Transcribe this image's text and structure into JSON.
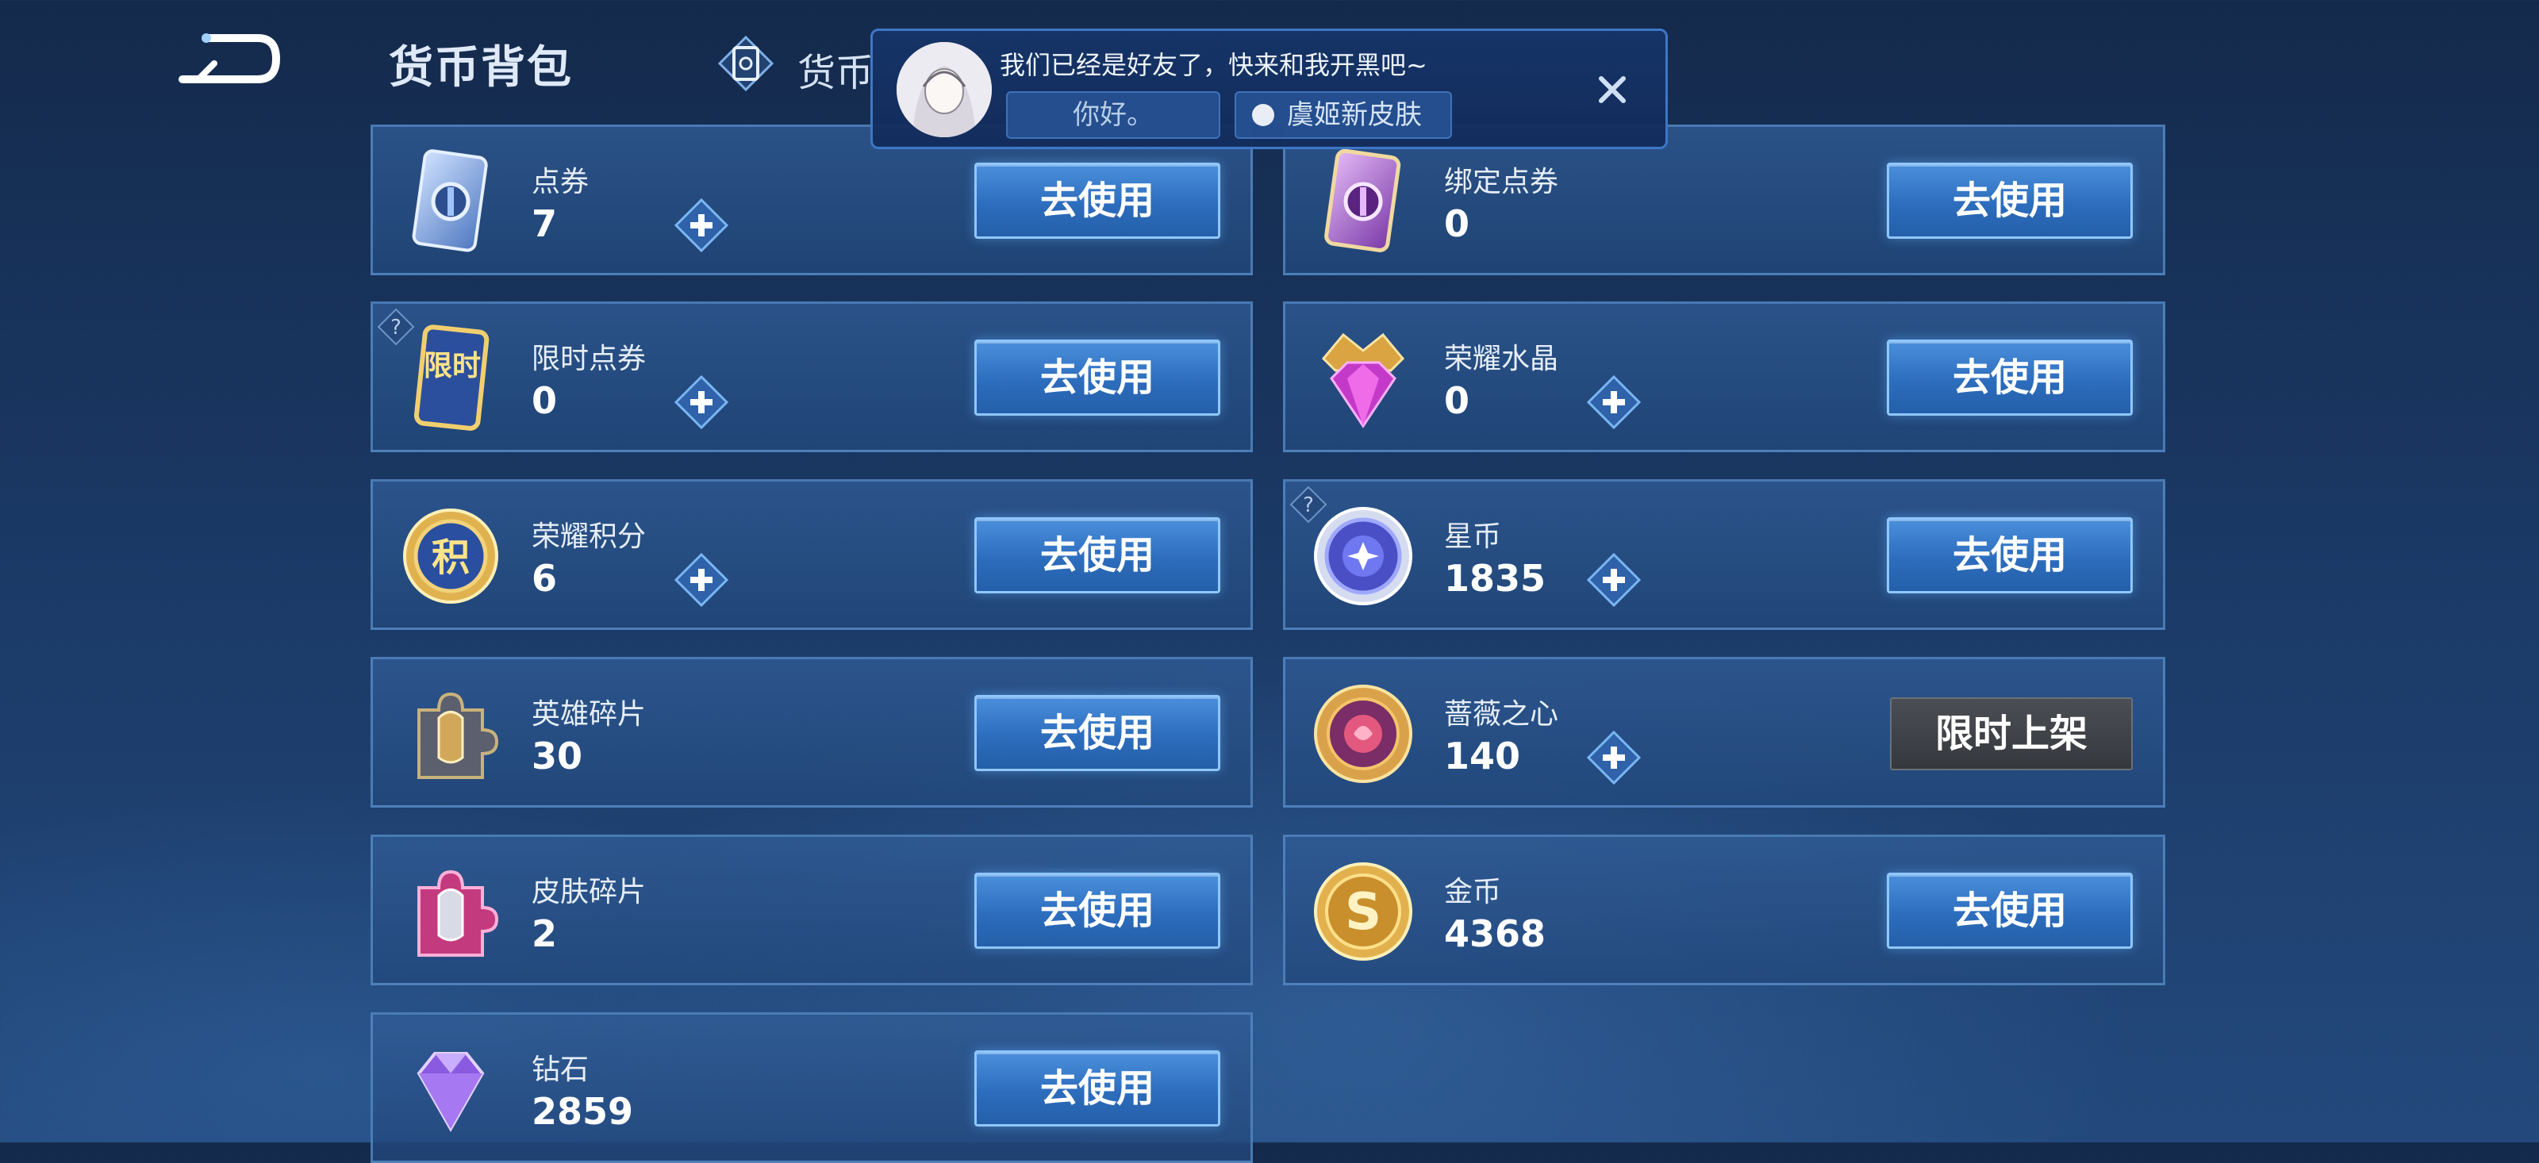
{
  "header": {
    "title": "货币背包",
    "tab_label": "货币"
  },
  "chat": {
    "message": "我们已经是好友了，快来和我开黑吧~",
    "quick_replies": [
      "你好。",
      "虞姬新皮肤"
    ]
  },
  "colors": {
    "accent": "#2d6dbd",
    "button_border": "#8fc7ff",
    "card_bg": "#2c5590",
    "disabled_button": "#3c3f44"
  },
  "currencies": [
    {
      "name": "点券",
      "value": "7",
      "button": "去使用",
      "icon": "coupon-ticket-icon"
    },
    {
      "name": "绑定点券",
      "value": "0",
      "button": "去使用",
      "icon": "bound-coupon-icon"
    },
    {
      "name": "限时点券",
      "value": "0",
      "button": "去使用",
      "icon": "limited-coupon-icon",
      "badge": "限时"
    },
    {
      "name": "荣耀水晶",
      "value": "0",
      "button": "去使用",
      "icon": "glory-crystal-icon"
    },
    {
      "name": "荣耀积分",
      "value": "6",
      "button": "去使用",
      "icon": "glory-points-icon",
      "badge": "积"
    },
    {
      "name": "星币",
      "value": "1835",
      "button": "去使用",
      "icon": "star-coin-icon"
    },
    {
      "name": "英雄碎片",
      "value": "30",
      "button": "去使用",
      "icon": "hero-fragment-icon"
    },
    {
      "name": "蔷薇之心",
      "value": "140",
      "button": "限时上架",
      "icon": "rose-heart-icon"
    },
    {
      "name": "皮肤碎片",
      "value": "2",
      "button": "去使用",
      "icon": "skin-fragment-icon"
    },
    {
      "name": "金币",
      "value": "4368",
      "button": "去使用",
      "icon": "gold-coin-icon",
      "badge": "S"
    },
    {
      "name": "钻石",
      "value": "2859",
      "button": "去使用",
      "icon": "diamond-icon"
    }
  ]
}
